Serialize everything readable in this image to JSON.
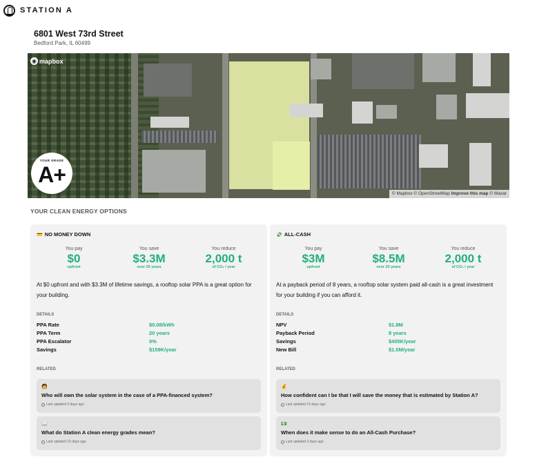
{
  "brand": {
    "name": "STATION A"
  },
  "address": {
    "street": "6801 West 73rd Street",
    "city": "Bedford Park, IL 60499"
  },
  "map": {
    "provider_logo": "mapbox",
    "attribution": [
      "© Mapbox",
      "© OpenStreetMap",
      "Improve this map",
      "© Maxar"
    ],
    "grade_label": "YOUR GRADE",
    "grade_value": "A+"
  },
  "section_title": "YOUR CLEAN ENERGY OPTIONS",
  "colors": {
    "accent": "#21b07a",
    "card_bg": "#f2f2f2",
    "related_bg": "#e1e1e1",
    "roof_highlight": "#e8f0a8"
  },
  "options": [
    {
      "icon": "credit-card-emoji",
      "icon_glyph": "💳",
      "title": "NO MONEY DOWN",
      "stats": [
        {
          "label": "You pay",
          "value": "$0",
          "sub": "upfront"
        },
        {
          "label": "You save",
          "value": "$3.3M",
          "sub": "over 20 years"
        },
        {
          "label": "You reduce",
          "value": "2,000 t",
          "sub": "of CO₂ / year"
        }
      ],
      "summary": "At $0 upfront and with $3.3M of lifetime savings, a rooftop solar PPA is a great option for your building.",
      "details_label": "DETAILS",
      "details": [
        {
          "key": "PPA Rate",
          "value": "$0.08/kWh"
        },
        {
          "key": "PPA Term",
          "value": "20 years"
        },
        {
          "key": "PPA Escalator",
          "value": "0%"
        },
        {
          "key": "Savings",
          "value": "$159K/year"
        }
      ],
      "related_label": "RELATED",
      "related": [
        {
          "icon": "person-emoji",
          "icon_glyph": "🧑",
          "question": "Who will own the solar system in the case of a PPA-financed system?",
          "updated": "Last updated 3 days ago"
        },
        {
          "icon": "book-emoji",
          "icon_glyph": "📖",
          "question": "What do Station A clean energy grades mean?",
          "updated": "Last updated 15 days ago"
        }
      ]
    },
    {
      "icon": "money-emoji",
      "icon_glyph": "💸",
      "title": "ALL-CASH",
      "stats": [
        {
          "label": "You pay",
          "value": "$3M",
          "sub": "upfront"
        },
        {
          "label": "You save",
          "value": "$8.5M",
          "sub": "over 20 years"
        },
        {
          "label": "You reduce",
          "value": "2,000 t",
          "sub": "of CO₂ / year"
        }
      ],
      "summary": "At a payback period of 8 years, a rooftop solar system paid all-cash is a great investment for your building if you can afford it.",
      "details_label": "DETAILS",
      "details": [
        {
          "key": "NPV",
          "value": "$1.8M"
        },
        {
          "key": "Payback Period",
          "value": "8 years"
        },
        {
          "key": "Savings",
          "value": "$405K/year"
        },
        {
          "key": "New Bill",
          "value": "$1.5M/year"
        }
      ],
      "related_label": "RELATED",
      "related": [
        {
          "icon": "money-bag-emoji",
          "icon_glyph": "💰",
          "question": "How confident can I be that I will save the money that is estimated by Station A?",
          "updated": "Last updated 15 days ago"
        },
        {
          "icon": "cash-emoji",
          "icon_glyph": "💵",
          "question": "When does it make sense to do an All-Cash Purchase?",
          "updated": "Last updated 3 days ago"
        }
      ]
    }
  ]
}
